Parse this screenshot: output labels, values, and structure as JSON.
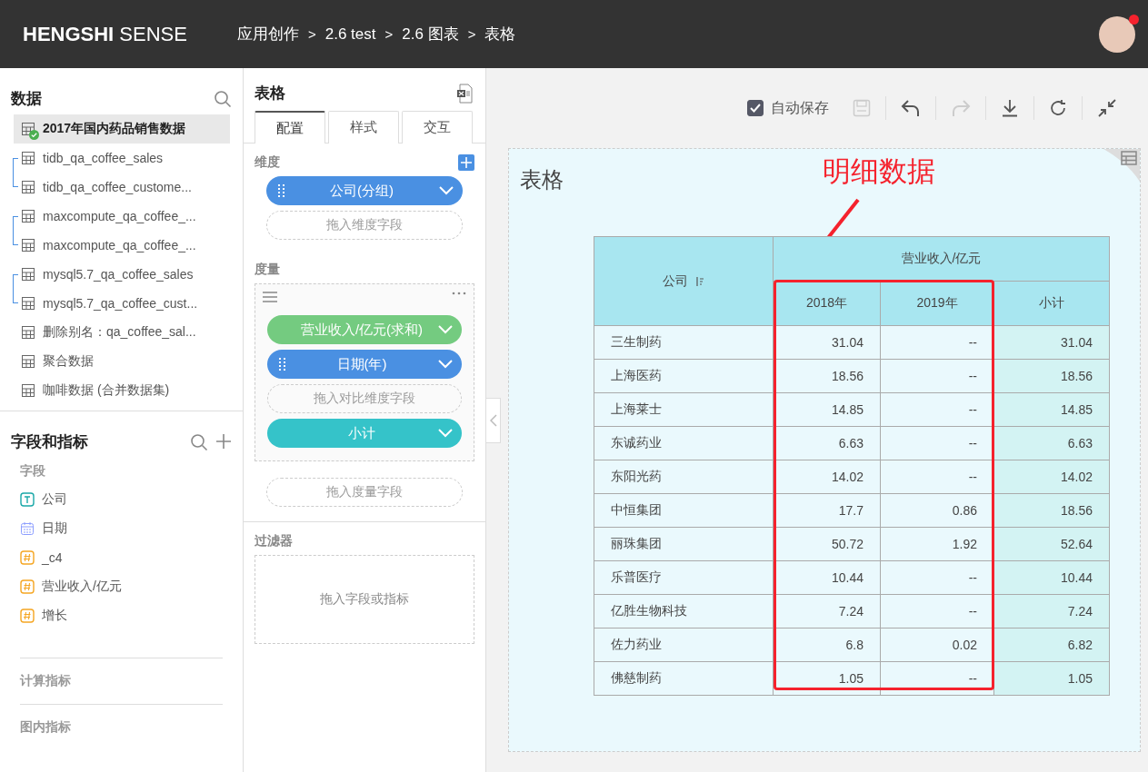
{
  "header": {
    "brand": "**HENGSHI** SENSE",
    "breadcrumb": [
      {
        "label": "应用创作",
        "separator": ">"
      },
      {
        "label": "2.6 test",
        "separator": ">"
      },
      {
        "label": "2.6 图表",
        "separator": ">"
      },
      {
        "label": "表格"
      }
    ],
    "avatar": {
      "notification": true
    }
  },
  "data_panel": {
    "title": "数据",
    "items": [
      {
        "kind": "dataset",
        "name": "2017年国内药品销售数据",
        "selected": true,
        "verified": true
      },
      {
        "kind": "group",
        "children": [
          {
            "kind": "dataset",
            "name": "tidb_qa_coffee_sales",
            "selected": false,
            "verified": false
          },
          {
            "kind": "dataset",
            "name": "tidb_qa_coffee_custome...",
            "selected": false,
            "verified": false
          }
        ]
      },
      {
        "kind": "group",
        "children": [
          {
            "kind": "dataset",
            "name": "maxcompute_qa_coffee_...",
            "selected": false,
            "verified": false
          },
          {
            "kind": "dataset",
            "name": "maxcompute_qa_coffee_...",
            "selected": false,
            "verified": false
          }
        ]
      },
      {
        "kind": "group",
        "children": [
          {
            "kind": "dataset",
            "name": "mysql5.7_qa_coffee_sales",
            "selected": false,
            "verified": false
          },
          {
            "kind": "dataset",
            "name": "mysql5.7_qa_coffee_cust...",
            "selected": false,
            "verified": false
          }
        ]
      },
      {
        "kind": "dataset",
        "name": "删除别名：qa_coffee_sal...",
        "selected": false,
        "verified": false
      },
      {
        "kind": "dataset",
        "name": "聚合数据",
        "selected": false,
        "verified": false
      },
      {
        "kind": "dataset",
        "name": "咖啡数据 (合并数据集)",
        "selected": false,
        "verified": false
      }
    ]
  },
  "fields_panel": {
    "title": "字段和指标",
    "section": "字段",
    "fields": [
      {
        "name": "公司",
        "kind": "text"
      },
      {
        "name": "日期",
        "kind": "date"
      },
      {
        "name": "_c4",
        "kind": "number"
      },
      {
        "name": "营业收入/亿元",
        "kind": "number"
      },
      {
        "name": "增长",
        "kind": "number"
      }
    ],
    "more_sections": [
      "计算指标",
      "图内指标"
    ]
  },
  "config_panel": {
    "title": "表格",
    "tabs": [
      {
        "label": "配置",
        "selected": true
      },
      {
        "label": "样式",
        "selected": false
      },
      {
        "label": "交互",
        "selected": false
      }
    ],
    "dimension": {
      "title": "维度",
      "pills": [
        {
          "label": "公司(分组)",
          "color": "#4a90e2",
          "handle": true
        }
      ],
      "drop": "拖入维度字段"
    },
    "measure": {
      "title": "度量",
      "items": [
        {
          "kind": "pill",
          "label": "营业收入/亿元(求和)",
          "color": "#74cb80",
          "handle": false
        },
        {
          "kind": "pill",
          "label": "日期(年)",
          "color": "#4a90e2",
          "handle": true
        },
        {
          "kind": "drop",
          "label": "拖入对比维度字段"
        },
        {
          "kind": "pill",
          "label": "小计",
          "color": "#35c3c9",
          "handle": false
        }
      ],
      "drop": "拖入度量字段"
    },
    "filter": {
      "title": "过滤器",
      "drop": "拖入字段或指标"
    }
  },
  "toolbar": {
    "autosave": {
      "label": "自动保存",
      "checked": true
    },
    "buttons": [
      {
        "kind": "save",
        "disabled": true
      },
      {
        "kind": "undo",
        "disabled": false
      },
      {
        "kind": "redo",
        "disabled": true
      },
      {
        "kind": "download",
        "disabled": false
      },
      {
        "kind": "refresh",
        "disabled": false
      },
      {
        "kind": "collapse",
        "disabled": false
      }
    ]
  },
  "chart": {
    "title": "表格",
    "annotation": "明细数据",
    "table": {
      "row_header": "公司",
      "group_header": "营业收入/亿元",
      "columns": [
        "2018年",
        "2019年"
      ],
      "subtotal_header": "小计",
      "rows": [
        {
          "company": "三生制药",
          "values": [
            "31.04",
            "--"
          ],
          "subtotal": "31.04"
        },
        {
          "company": "上海医药",
          "values": [
            "18.56",
            "--"
          ],
          "subtotal": "18.56"
        },
        {
          "company": "上海莱士",
          "values": [
            "14.85",
            "--"
          ],
          "subtotal": "14.85"
        },
        {
          "company": "东诚药业",
          "values": [
            "6.63",
            "--"
          ],
          "subtotal": "6.63"
        },
        {
          "company": "东阳光药",
          "values": [
            "14.02",
            "--"
          ],
          "subtotal": "14.02"
        },
        {
          "company": "中恒集团",
          "values": [
            "17.7",
            "0.86"
          ],
          "subtotal": "18.56"
        },
        {
          "company": "丽珠集团",
          "values": [
            "50.72",
            "1.92"
          ],
          "subtotal": "52.64"
        },
        {
          "company": "乐普医疗",
          "values": [
            "10.44",
            "--"
          ],
          "subtotal": "10.44"
        },
        {
          "company": "亿胜生物科技",
          "values": [
            "7.24",
            "--"
          ],
          "subtotal": "7.24"
        },
        {
          "company": "佐力药业",
          "values": [
            "6.8",
            "0.02"
          ],
          "subtotal": "6.82"
        },
        {
          "company": "佛慈制药",
          "values": [
            "1.05",
            "--"
          ],
          "subtotal": "1.05"
        }
      ]
    }
  }
}
